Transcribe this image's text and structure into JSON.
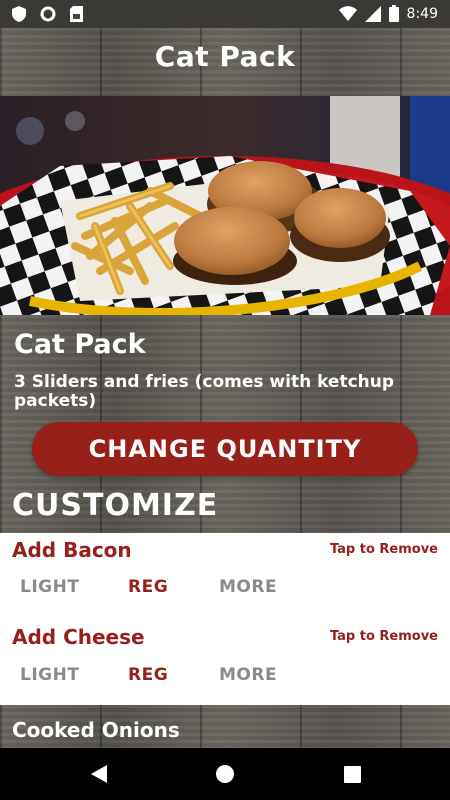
{
  "status_bar": {
    "time": "8:49",
    "icons": [
      "shield-icon",
      "circle-icon",
      "sim-card-icon",
      "wifi-icon",
      "signal-icon",
      "battery-icon"
    ]
  },
  "header": {
    "title": "Cat Pack"
  },
  "hero": {
    "image": "sliders-and-fries-basket"
  },
  "product": {
    "name": "Cat Pack",
    "description": "3 Sliders and fries (comes with ketchup packets)"
  },
  "actions": {
    "change_quantity_label": "CHANGE QUANTITY"
  },
  "customize": {
    "title": "CUSTOMIZE",
    "options": [
      {
        "name": "Add Bacon",
        "remove_label": "Tap to Remove",
        "levels": [
          "LIGHT",
          "REG",
          "MORE"
        ],
        "selected": "REG"
      },
      {
        "name": "Add Cheese",
        "remove_label": "Tap to Remove",
        "levels": [
          "LIGHT",
          "REG",
          "MORE"
        ],
        "selected": "REG"
      }
    ]
  },
  "next_section": {
    "title": "Cooked Onions"
  },
  "nav_bar": {
    "icons": [
      "back-icon",
      "home-icon",
      "recents-icon"
    ]
  },
  "colors": {
    "accent": "#98201a",
    "inactive": "#8a8a8a",
    "card": "#ffffff"
  }
}
